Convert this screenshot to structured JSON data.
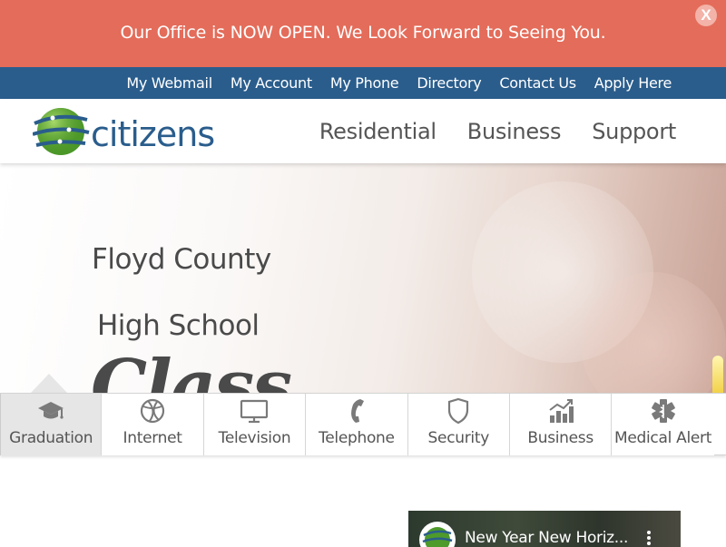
{
  "alert": {
    "message": "Our Office is NOW OPEN. We Look Forward to Seeing You.",
    "close_label": "X",
    "background": "#e46c5a"
  },
  "utility_nav": {
    "background": "#2a5d8c",
    "links": [
      "My Webmail",
      "My Account",
      "My Phone",
      "Directory",
      "Contact Us",
      "Apply Here"
    ]
  },
  "header": {
    "logo_text": "citizens",
    "brand_color": "#2a5d8c",
    "nav": [
      "Residential",
      "Business",
      "Support"
    ]
  },
  "hero": {
    "line1": "Floyd County",
    "line2": "High School",
    "script": "Class"
  },
  "service_tabs": [
    {
      "label": "Graduation",
      "icon": "graduation-cap-icon",
      "active": true
    },
    {
      "label": "Internet",
      "icon": "globe-icon",
      "active": false
    },
    {
      "label": "Television",
      "icon": "monitor-icon",
      "active": false
    },
    {
      "label": "Telephone",
      "icon": "phone-icon",
      "active": false
    },
    {
      "label": "Security",
      "icon": "shield-icon",
      "active": false
    },
    {
      "label": "Business",
      "icon": "chart-icon",
      "active": false
    },
    {
      "label": "Medical Alert",
      "icon": "medical-icon",
      "active": false
    }
  ],
  "video": {
    "title": "New Year New Horiz..."
  }
}
